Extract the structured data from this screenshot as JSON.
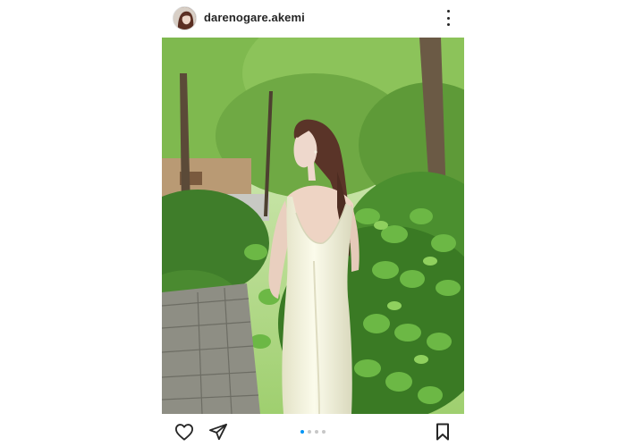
{
  "post": {
    "username": "darenogare.akemi",
    "carousel": {
      "total": 4,
      "active": 1
    }
  },
  "icons": {
    "avatar": "profile-photo",
    "more": "more-options-icon",
    "like": "heart-icon",
    "share": "paper-plane-icon",
    "save": "bookmark-icon"
  },
  "colors": {
    "accent": "#0095f6",
    "text": "#262626",
    "inactive_dot": "#c7c7c7"
  }
}
